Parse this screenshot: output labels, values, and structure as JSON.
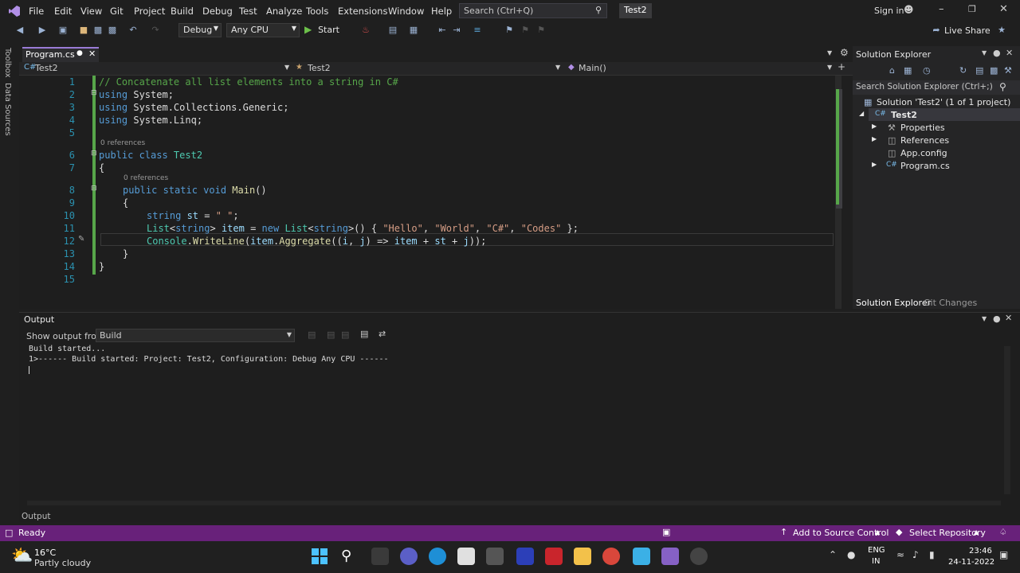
{
  "menu": [
    "File",
    "Edit",
    "View",
    "Git",
    "Project",
    "Build",
    "Debug",
    "Test",
    "Analyze",
    "Tools",
    "Extensions",
    "Window",
    "Help"
  ],
  "search": {
    "placeholder": "Search (Ctrl+Q)"
  },
  "solution_badge": "Test2",
  "account": {
    "signin": "Sign in"
  },
  "toolbar": {
    "config": "Debug",
    "platform": "Any CPU",
    "start": "Start",
    "live_share": "Live Share"
  },
  "left_rail": [
    "Toolbox",
    "Data Sources"
  ],
  "editor": {
    "tab": "Program.cs",
    "nav_project": "Test2",
    "nav_class": "Test2",
    "nav_member": "Main()",
    "codelens_1": "0 references",
    "codelens_2": "0 references",
    "lines": [
      "1",
      "2",
      "3",
      "4",
      "5",
      "6",
      "7",
      "8",
      "9",
      "10",
      "11",
      "12",
      "13",
      "14",
      "15"
    ]
  },
  "code": {
    "l1": "// Concatenate all list elements into a string in C#",
    "l2_kw": "using",
    "l2_rest": " System;",
    "l3_kw": "using",
    "l3_rest": " System.Collections.Generic;",
    "l4_kw": "using",
    "l4_rest": " System.Linq;",
    "l6_kw": "public class",
    "l6_name": " Test2",
    "l7": "{",
    "l8_kw": "public static void",
    "l8_fn": " Main",
    "l8_rest": "()",
    "l9": "{",
    "l10_kw": "string",
    "l10_var": " st",
    "l10_op": " = ",
    "l10_str": "\" \"",
    "l10_end": ";",
    "l11_ty": "List",
    "l11_a": "<",
    "l11_kw": "string",
    "l11_b": "> ",
    "l11_var": "item",
    "l11_c": " = ",
    "l11_new": "new",
    "l11_ty2": " List",
    "l11_d": "<",
    "l11_kw2": "string",
    "l11_e": ">() { ",
    "l11_s1": "\"Hello\"",
    "l11_s2": "\"World\"",
    "l11_s3": "\"C#\"",
    "l11_s4": "\"Codes\"",
    "l11_end": " };",
    "l12_ty": "Console",
    "l12_a": ".",
    "l12_fn": "WriteLine",
    "l12_b": "(",
    "l12_var": "item",
    "l12_c": ".",
    "l12_fn2": "Aggregate",
    "l12_d": "((",
    "l12_i": "i",
    "l12_e": ", ",
    "l12_j": "j",
    "l12_f": ") => ",
    "l12_var2": "item",
    "l12_g": " + ",
    "l12_var3": "st",
    "l12_h": " + ",
    "l12_j2": "j",
    "l12_end": "));",
    "l13": "}",
    "l14": "}"
  },
  "solution_explorer": {
    "title": "Solution Explorer",
    "search_placeholder": "Search Solution Explorer (Ctrl+;)",
    "solution": "Solution 'Test2' (1 of 1 project)",
    "project": "Test2",
    "items": [
      "Properties",
      "References",
      "App.config",
      "Program.cs"
    ],
    "tab_active": "Solution Explorer",
    "tab_other": "Git Changes"
  },
  "output": {
    "title": "Output",
    "show_from_label": "Show output from:",
    "source": "Build",
    "line1": "Build started...",
    "line2": "1>------ Build started: Project: Test2, Configuration: Debug Any CPU ------",
    "bottom_tab": "Output"
  },
  "status": {
    "ready": "Ready",
    "add_source": "Add to Source Control",
    "repo": "Select Repository"
  },
  "taskbar": {
    "weather_temp": "16°C",
    "weather_desc": "Partly cloudy",
    "lang1": "ENG",
    "lang2": "IN",
    "time": "23:46",
    "date": "24-11-2022"
  },
  "colors": {
    "accent": "#68217a",
    "tab_accent": "#9a7bd6",
    "keyword": "#569cd6",
    "type": "#4ec9b0",
    "string": "#d69d85",
    "comment": "#57a64a"
  }
}
